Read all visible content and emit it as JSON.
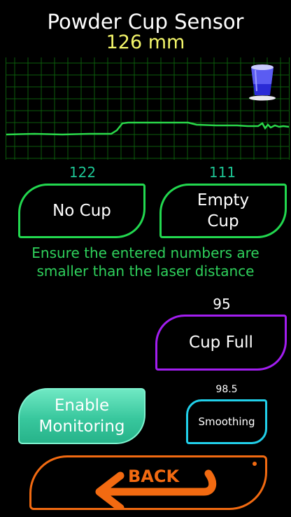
{
  "header": {
    "title": "Powder Cup Sensor",
    "reading": "126 mm"
  },
  "calibration": {
    "no_cup": {
      "value": "122",
      "label": "No Cup"
    },
    "empty_cup": {
      "value": "111",
      "label_line1": "Empty",
      "label_line2": "Cup"
    },
    "note_line1": "Ensure the entered numbers are",
    "note_line2": "smaller than the laser distance",
    "cup_full": {
      "value": "95",
      "label": "Cup Full"
    }
  },
  "monitoring": {
    "label_line1": "Enable",
    "label_line2": "Monitoring"
  },
  "smoothing": {
    "value": "98.5",
    "label": "Smoothing"
  },
  "back": {
    "label": "BACK"
  },
  "colors": {
    "accent_green": "#22d84f",
    "accent_purple": "#a21ef0",
    "accent_cyan": "#21d0ea",
    "accent_orange": "#f26a11",
    "value_teal": "#1dc493",
    "reading_yellow": "#f3f56a"
  },
  "icons": {
    "cup": "cup-icon",
    "back": "back-arrow-icon"
  }
}
